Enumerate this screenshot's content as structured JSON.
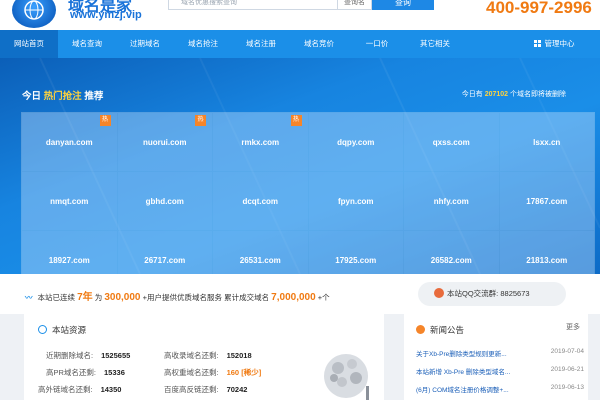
{
  "header": {
    "logo_title": "域名是家",
    "logo_url": "www.ymzj.vip",
    "search_placeholder": "域名优惠搜索查询",
    "search_select": "查询名",
    "search_button": "查询",
    "hotline": "400-997-2996"
  },
  "nav": {
    "items": [
      "网站首页",
      "域名查询",
      "过期域名",
      "域名抢注",
      "域名注册",
      "域名竞价",
      "一口价",
      "其它相关"
    ],
    "admin": "管理中心"
  },
  "hero": {
    "head_prefix": "今日",
    "head_highlight": "热门抢注",
    "head_suffix": "推荐",
    "count_prefix": "今日有",
    "count_value": "207102",
    "count_suffix": "个域名即将被删除",
    "hot_label": "热",
    "domains": [
      {
        "name": "danyan.com",
        "hot": true
      },
      {
        "name": "nuorui.com",
        "hot": true
      },
      {
        "name": "rmkx.com",
        "hot": true
      },
      {
        "name": "dqpy.com",
        "hot": false
      },
      {
        "name": "qxss.com",
        "hot": false
      },
      {
        "name": "lsxx.cn",
        "hot": false
      },
      {
        "name": "nmqt.com",
        "hot": false
      },
      {
        "name": "gbhd.com",
        "hot": false
      },
      {
        "name": "dcqt.com",
        "hot": false
      },
      {
        "name": "fpyn.com",
        "hot": false
      },
      {
        "name": "nhfy.com",
        "hot": false
      },
      {
        "name": "17867.com",
        "hot": false
      },
      {
        "name": "18927.com",
        "hot": false
      },
      {
        "name": "26717.com",
        "hot": false
      },
      {
        "name": "26531.com",
        "hot": false
      },
      {
        "name": "17925.com",
        "hot": false
      },
      {
        "name": "26582.com",
        "hot": false
      },
      {
        "name": "21813.com",
        "hot": false
      }
    ]
  },
  "stats": {
    "part1": "本站已连续",
    "years": "7年",
    "part2": "为",
    "users": "300,000",
    "part3": "+用户提供优质域名服务",
    "part4": "累计成交域名",
    "deals": "7,000,000",
    "part5": "+个",
    "qq_label": "本站QQ交流群:",
    "qq_number": "8825673"
  },
  "resources": {
    "title": "本站资源",
    "rows": [
      {
        "l_label": "近期删除域名:",
        "l_value": "1525655",
        "r_label": "高收录域名还剩:",
        "r_value": "152018"
      },
      {
        "l_label": "高PR域名还剩:",
        "l_value": "15336",
        "r_label": "高权重域名还剩:",
        "r_value": "160 [稀少]"
      },
      {
        "l_label": "高外链域名还剩:",
        "l_value": "14350",
        "r_label": "百度高反链还剩:",
        "r_value": "70242"
      }
    ]
  },
  "news": {
    "title": "新闻公告",
    "more": "更多",
    "items": [
      {
        "text": "关于Xb-Pre删除类型规则更新...",
        "date": "2019-07-04"
      },
      {
        "text": "本站新增 Xb-Pre 删除类型域名...",
        "date": "2019-06-21"
      },
      {
        "text": "(6月) COM域名注册价格调整+...",
        "date": "2019-06-13"
      }
    ]
  }
}
